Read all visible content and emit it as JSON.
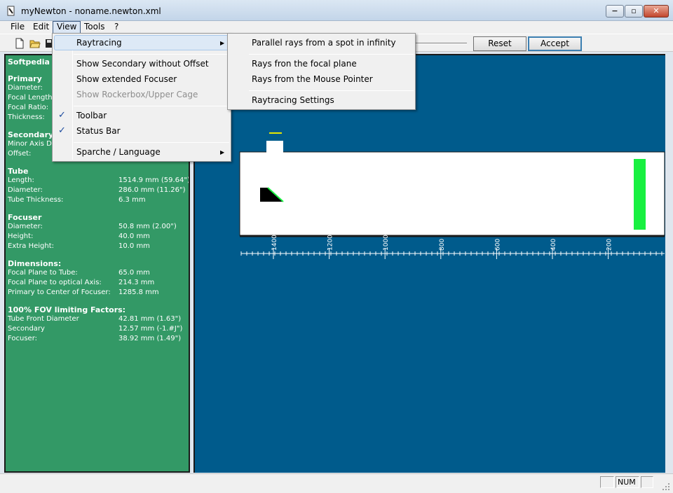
{
  "window": {
    "title": "myNewton - noname.newton.xml",
    "minimize": "−",
    "maximize": "▫",
    "close": "✕"
  },
  "menubar": {
    "items": [
      "File",
      "Edit",
      "View",
      "Tools",
      "?"
    ]
  },
  "toolbar": {
    "reset_label": "Reset",
    "accept_label": "Accept"
  },
  "view_menu": {
    "items": [
      {
        "label": "Raytracing",
        "submenu": true,
        "checked": false,
        "disabled": false
      },
      {
        "label": "Show Secondary without Offset",
        "checked": false,
        "disabled": false
      },
      {
        "label": "Show extended Focuser",
        "checked": false,
        "disabled": false
      },
      {
        "label": "Show Rockerbox/Upper Cage",
        "checked": false,
        "disabled": true
      },
      {
        "label": "Toolbar",
        "checked": true,
        "disabled": false
      },
      {
        "label": "Status Bar",
        "checked": true,
        "disabled": false
      },
      {
        "label": "Sparche / Language",
        "submenu": true,
        "checked": false,
        "disabled": false
      }
    ]
  },
  "raytracing_menu": {
    "items": [
      "Parallel rays from a spot in infinity",
      "Rays fron the focal plane",
      "Rays from the Mouse Pointer",
      "Raytracing Settings"
    ]
  },
  "info": {
    "header": "Softpedia",
    "primary": {
      "title": "Primary",
      "rows": [
        "Diameter:",
        "Focal Length:",
        "Focal Ratio:",
        "Thickness:"
      ]
    },
    "secondary": {
      "title": "Secondary",
      "rows": [
        "Minor Axis Di",
        "Offset:"
      ]
    },
    "tube": {
      "title": "Tube",
      "rows": [
        {
          "label": "Length:",
          "value": "1514.9 mm (59.64\")"
        },
        {
          "label": "Diameter:",
          "value": "286.0 mm (11.26\")"
        },
        {
          "label": "Tube Thickness:",
          "value": "6.3 mm"
        }
      ]
    },
    "focuser": {
      "title": "Focuser",
      "rows": [
        {
          "label": "Diameter:",
          "value": "50.8 mm (2.00\")"
        },
        {
          "label": "Height:",
          "value": "40.0 mm"
        },
        {
          "label": "Extra Height:",
          "value": "10.0 mm"
        }
      ]
    },
    "dimensions": {
      "title": "Dimensions:",
      "rows": [
        {
          "label": "Focal Plane to Tube:",
          "value": "65.0 mm"
        },
        {
          "label": "Focal Plane to  optical Axis:",
          "value": "214.3 mm"
        },
        {
          "label": "Primary to Center of Focuser:",
          "value": "1285.8 mm"
        }
      ]
    },
    "fov": {
      "title": "100% FOV limiting Factors:",
      "rows": [
        {
          "label": "Tube Front Diameter",
          "value": "42.81 mm  (1.63\")"
        },
        {
          "label": "Secondary",
          "value": "12.57 mm  (-1.#J\")"
        },
        {
          "label": "Focuser:",
          "value": "38.92 mm  (1.49\")"
        }
      ]
    }
  },
  "scale": {
    "ticks": [
      "1400",
      "1200",
      "1000",
      "800",
      "600",
      "400",
      "200"
    ]
  },
  "statusbar": {
    "num": "NUM"
  },
  "colors": {
    "canvas_bg": "#005b8c",
    "panel_bg": "#339966",
    "mirror_green": "#18f040"
  }
}
